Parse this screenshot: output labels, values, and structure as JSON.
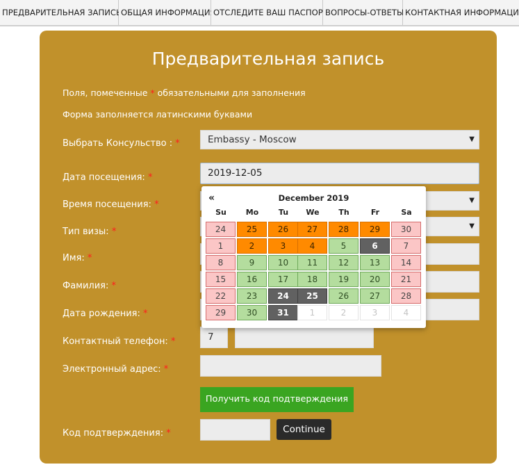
{
  "nav": [
    "Предварительная запись",
    "Общая информация",
    "Отследите ваш паспорт",
    "Вопросы-ответы",
    "Контактная информация"
  ],
  "form": {
    "title": "Предварительная запись",
    "note1_a": "Поля, помеченные",
    "note1_b": "обязательными для заполнения",
    "note2": "Форма заполняется латинскими буквами",
    "asterisk": "*",
    "labels": {
      "consulate": "Выбрать Консульство :",
      "date": "Дата посещения:",
      "time": "Время посещения:",
      "visa": "Тип визы:",
      "name": "Имя:",
      "surname": "Фамилия:",
      "birth": "Дата рождения:",
      "phone": "Контактный телефон:",
      "email": "Электронный адрес:",
      "code": "Код подтверждения:"
    },
    "consulate_value": "Embassy - Moscow",
    "date_value": "2019-12-05",
    "phone_prefix": "7",
    "get_code_label": "Получить код подтверждения",
    "continue_label": "Continue"
  },
  "datepicker": {
    "prev": "«",
    "month": "December 2019",
    "weekdays": [
      "Su",
      "Mo",
      "Tu",
      "We",
      "Th",
      "Fr",
      "Sa"
    ],
    "weeks": [
      [
        [
          "24",
          "weekend"
        ],
        [
          "25",
          "busy"
        ],
        [
          "26",
          "busy"
        ],
        [
          "27",
          "busy"
        ],
        [
          "28",
          "busy"
        ],
        [
          "29",
          "busy"
        ],
        [
          "30",
          "weekend"
        ]
      ],
      [
        [
          "1",
          "weekend"
        ],
        [
          "2",
          "busy"
        ],
        [
          "3",
          "busy"
        ],
        [
          "4",
          "busy"
        ],
        [
          "5",
          "free"
        ],
        [
          "6",
          "closed"
        ],
        [
          "7",
          "weekend"
        ]
      ],
      [
        [
          "8",
          "weekend"
        ],
        [
          "9",
          "free"
        ],
        [
          "10",
          "free"
        ],
        [
          "11",
          "free"
        ],
        [
          "12",
          "free"
        ],
        [
          "13",
          "free"
        ],
        [
          "14",
          "weekend"
        ]
      ],
      [
        [
          "15",
          "weekend"
        ],
        [
          "16",
          "free"
        ],
        [
          "17",
          "free"
        ],
        [
          "18",
          "free"
        ],
        [
          "19",
          "free"
        ],
        [
          "20",
          "free"
        ],
        [
          "21",
          "weekend"
        ]
      ],
      [
        [
          "22",
          "weekend"
        ],
        [
          "23",
          "free"
        ],
        [
          "24",
          "closed"
        ],
        [
          "25",
          "closed"
        ],
        [
          "26",
          "free"
        ],
        [
          "27",
          "free"
        ],
        [
          "28",
          "weekend"
        ]
      ],
      [
        [
          "29",
          "weekend"
        ],
        [
          "30",
          "free"
        ],
        [
          "31",
          "closed"
        ],
        [
          "1",
          "next"
        ],
        [
          "2",
          "next"
        ],
        [
          "3",
          "next"
        ],
        [
          "4",
          "next"
        ]
      ]
    ]
  },
  "colors": {
    "panel": "#c1912b",
    "weekend": "#fbc6c6",
    "busy": "#ff8a00",
    "free": "#b4dd9e",
    "closed": "#616161",
    "button_green": "#3aa521"
  }
}
